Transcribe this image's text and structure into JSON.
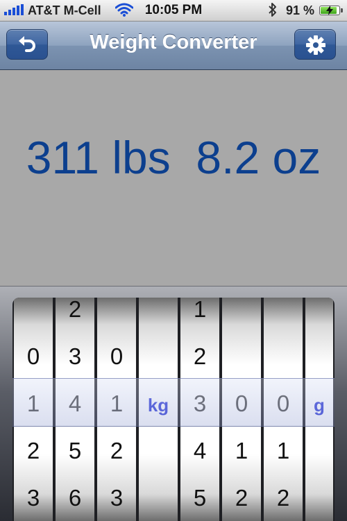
{
  "status": {
    "carrier": "AT&T M-Cell",
    "time": "10:05 PM",
    "battery": "91 %",
    "battery_level": 0.91
  },
  "nav": {
    "title": "Weight Converter",
    "undo_icon": "undo-arrow-icon",
    "settings_icon": "gear-icon"
  },
  "display": {
    "readout": "311 lbs  8.2 oz"
  },
  "picker": {
    "columns": [
      {
        "above2": "",
        "above1": "0",
        "selected": "1",
        "below1": "2",
        "below2": "3"
      },
      {
        "above2": "2",
        "above1": "3",
        "selected": "4",
        "below1": "5",
        "below2": "6"
      },
      {
        "above2": "",
        "above1": "0",
        "selected": "1",
        "below1": "2",
        "below2": "3"
      },
      {
        "unit": "kg"
      },
      {
        "above2": "1",
        "above1": "2",
        "selected": "3",
        "below1": "4",
        "below2": "5"
      },
      {
        "above2": "",
        "above1": "",
        "selected": "0",
        "below1": "1",
        "below2": "2"
      },
      {
        "above2": "",
        "above1": "",
        "selected": "0",
        "below1": "1",
        "below2": "2"
      },
      {
        "unit": "g"
      }
    ]
  },
  "colors": {
    "readout": "#0c3f8e",
    "unit": "#2e3bd6",
    "nav_button": "#2f5896"
  }
}
